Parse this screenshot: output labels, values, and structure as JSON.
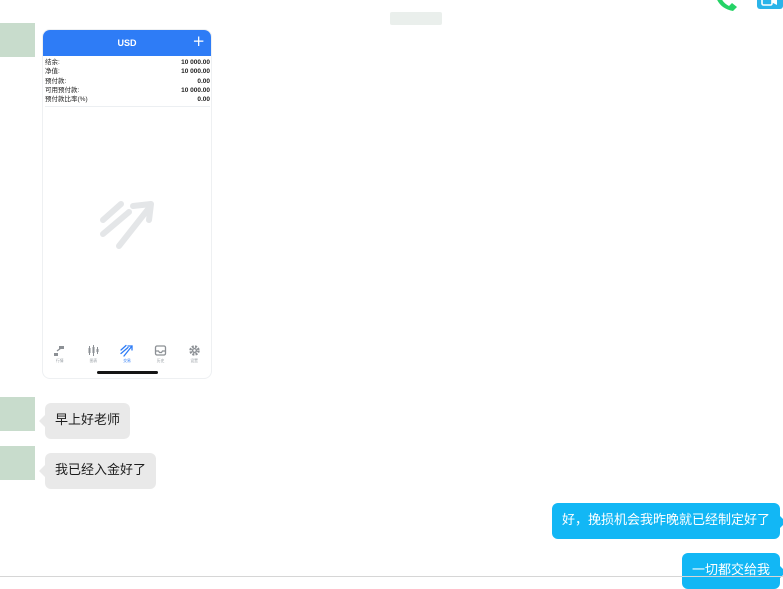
{
  "chat": {
    "messages": [
      {
        "direction": "incoming",
        "type": "image"
      },
      {
        "direction": "incoming",
        "type": "text",
        "text": "早上好老师"
      },
      {
        "direction": "incoming",
        "type": "text",
        "text": "我已经入金好了"
      },
      {
        "direction": "outgoing",
        "type": "text",
        "text": "好，挽损机会我昨晚就已经制定好了"
      },
      {
        "direction": "outgoing",
        "type": "text",
        "text": "一切都交给我"
      }
    ]
  },
  "header": {
    "icons": [
      "phone-call-icon",
      "video-call-icon"
    ],
    "colors": {
      "phone": "#25d366",
      "video": "#2bb4e9"
    }
  },
  "screenshot": {
    "currency": "USD",
    "add_icon": "+",
    "rows": [
      {
        "label": "结余:",
        "value": "10 000.00"
      },
      {
        "label": "净值:",
        "value": "10 000.00"
      },
      {
        "label": "预付款:",
        "value": "0.00"
      },
      {
        "label": "可用预付款:",
        "value": "10 000.00"
      },
      {
        "label": "预付款比率(%)",
        "value": "0.00"
      }
    ],
    "empty_state_icon": "trade-chart-icon",
    "tabs": [
      {
        "label": "行情",
        "icon": "quotes-icon",
        "active": false
      },
      {
        "label": "图表",
        "icon": "chart-icon",
        "active": false
      },
      {
        "label": "交易",
        "icon": "trade-icon",
        "active": true
      },
      {
        "label": "历史",
        "icon": "history-icon",
        "active": false
      },
      {
        "label": "设置",
        "icon": "settings-icon",
        "active": false
      }
    ]
  },
  "colors": {
    "accent_blue": "#2e7cf6",
    "outgoing_bubble": "#12b7f5",
    "incoming_bubble": "#e9e9e9",
    "avatar": "#c8dccc"
  }
}
